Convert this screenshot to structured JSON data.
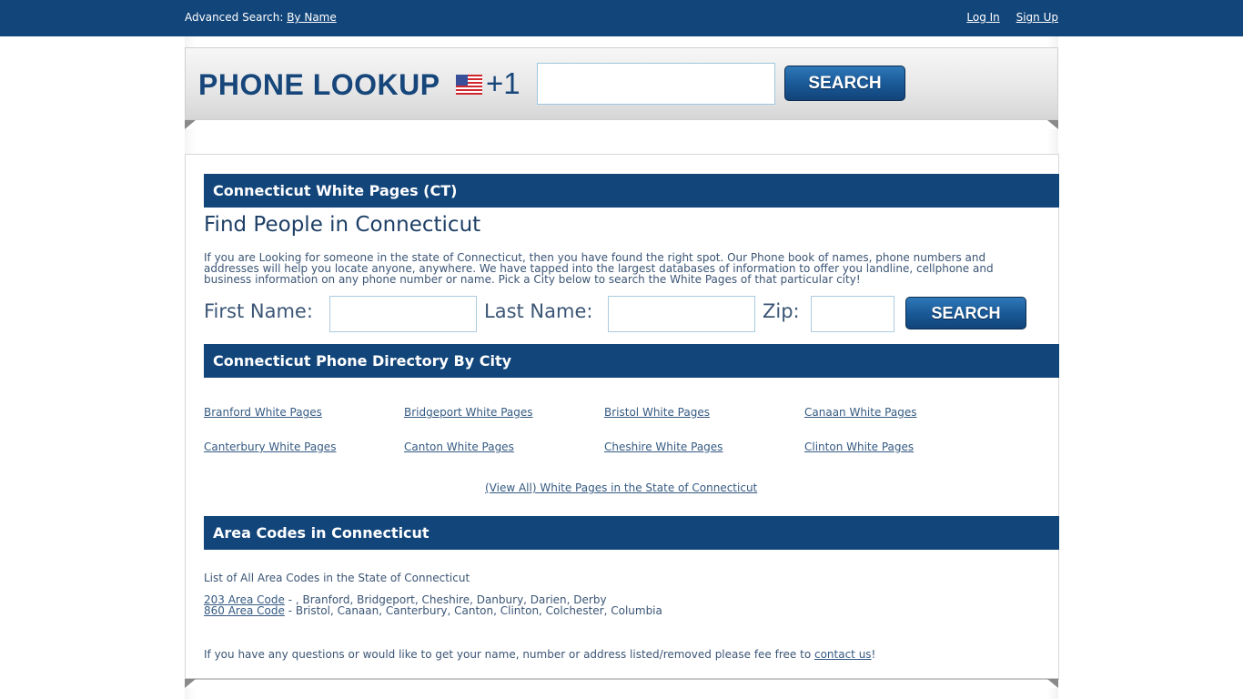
{
  "topbar": {
    "advanced_label": "Advanced Search:",
    "advanced_link": "By Name",
    "login": "Log In",
    "signup": "Sign Up"
  },
  "banner": {
    "title": "PHONE LOOKUP",
    "flag_icon": "us-flag-icon",
    "country_code": "+1",
    "phone_input_value": "",
    "search_label": "SEARCH"
  },
  "colors": {
    "brand_navy": "#12457a",
    "link": "#355a82",
    "text": "#3b5575"
  },
  "main": {
    "section1_title": "Connecticut White Pages (CT)",
    "heading": "Find People in Connecticut",
    "intro_lines": [
      "If you are Looking for someone in the state of Connecticut, then you have found the right spot. Our Phone book of names, phone numbers and",
      "addresses will help you locate anyone, anywhere. We have tapped into the largest databases of information to offer you landline, cellphone and",
      "business information on any phone number or name. Pick a City below to search the White Pages of that particular city!"
    ],
    "form": {
      "first_name_label": "First Name:",
      "first_name_value": "",
      "last_name_label": "Last Name:",
      "last_name_value": "",
      "zip_label": "Zip:",
      "zip_value": "",
      "search_label": "SEARCH"
    },
    "section2_title": "Connecticut Phone Directory By City",
    "cities": [
      "Branford White Pages",
      "Bridgeport White Pages",
      "Bristol White Pages",
      "Canaan White Pages",
      "Canterbury White Pages",
      "Canton White Pages",
      "Cheshire White Pages",
      "Clinton White Pages"
    ],
    "view_all": "(View All) White Pages in the State of Connecticut",
    "section3_title": "Area Codes in Connecticut",
    "area_codes_intro": "List of All Area Codes in the State of Connecticut",
    "area_codes": [
      {
        "code": "203 Area Code",
        "cities": " - , Branford, Bridgeport, Cheshire, Danbury, Darien, Derby"
      },
      {
        "code": "860 Area Code",
        "cities": " - Bristol, Canaan, Canterbury, Canton, Clinton, Colchester, Columbia"
      }
    ],
    "footer_text": "If you have any questions or would like to get your name, number or address listed/removed please fee free to ",
    "footer_link": "contact us",
    "footer_end": "!"
  }
}
